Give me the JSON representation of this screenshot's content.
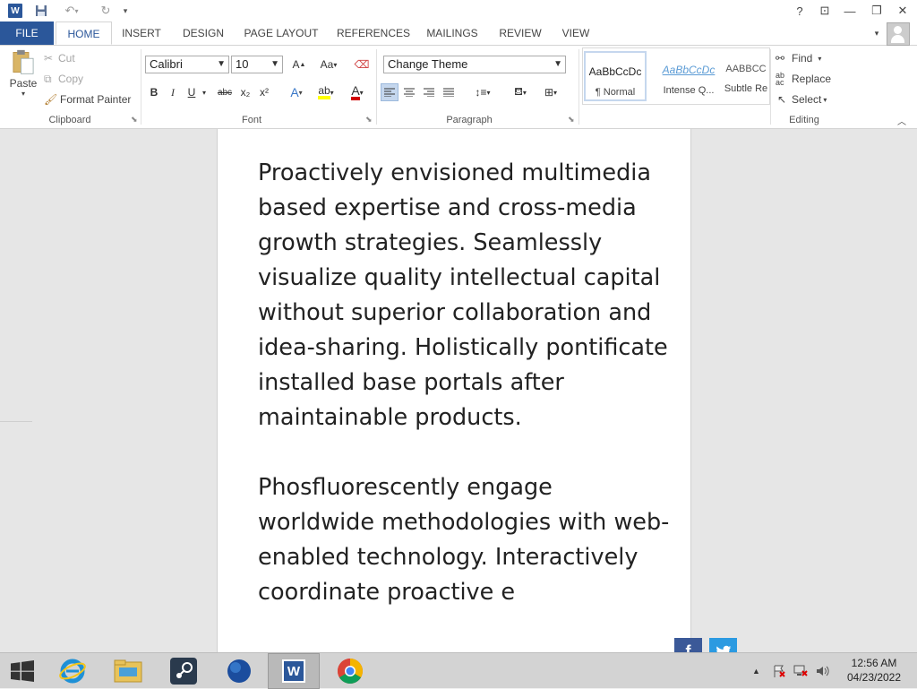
{
  "titlebar": {
    "help": "?",
    "ribbon_display": "⊡",
    "minimize": "—",
    "restore": "❐",
    "close": "✕"
  },
  "tabs": [
    {
      "label": "FILE"
    },
    {
      "label": "HOME"
    },
    {
      "label": "INSERT"
    },
    {
      "label": "DESIGN"
    },
    {
      "label": "PAGE LAYOUT"
    },
    {
      "label": "REFERENCES"
    },
    {
      "label": "MAILINGS"
    },
    {
      "label": "REVIEW"
    },
    {
      "label": "VIEW"
    }
  ],
  "clipboard": {
    "paste": "Paste",
    "cut": "Cut",
    "copy": "Copy",
    "format_painter": "Format Painter",
    "group_label": "Clipboard"
  },
  "font": {
    "family": "Calibri",
    "size": "10",
    "group_label": "Font",
    "grow": "A",
    "change_case": "Aa",
    "bold": "B",
    "italic": "I",
    "underline": "U",
    "strike": "abc",
    "subscript": "x₂",
    "superscript": "x²"
  },
  "paragraph": {
    "group_label": "Paragraph"
  },
  "theme": {
    "value": "Change Theme"
  },
  "styles": [
    {
      "sample": "AaBbCcDc",
      "name": "¶ Normal"
    },
    {
      "sample": "AaBbCcDc",
      "name": "Intense Q..."
    },
    {
      "sample": "AABBCC",
      "name": "Subtle Re"
    }
  ],
  "editing": {
    "find": "Find",
    "replace": "Replace",
    "select": "Select",
    "group_label": "Editing"
  },
  "document": {
    "paragraphs": [
      "Proactively envisioned multimedia based expertise and cross-media growth strategies. Seamlessly visualize quality intellectual capital without superior collaboration and idea-sharing. Holistically pontificate installed base portals after maintainable products.",
      "Phosfluorescently engage worldwide methodologies with web-enabled technology. Interactively coordinate proactive e"
    ]
  },
  "social": {
    "facebook": "f",
    "twitter": "t"
  },
  "clock": {
    "time": "12:56 AM",
    "date": "04/23/2022"
  },
  "colors": {
    "accent": "#2b579a",
    "facebook": "#3b5998",
    "twitter": "#2b9ae1"
  }
}
